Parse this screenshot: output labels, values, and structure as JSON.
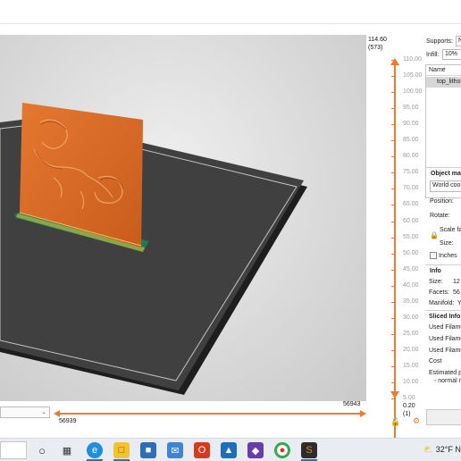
{
  "vertical_slider": {
    "top_value": "114.60",
    "top_layer": "(573)",
    "ticks": [
      "110.00",
      "105.00",
      "100.00",
      "95.00",
      "90.00",
      "85.00",
      "80.00",
      "75.00",
      "70.00",
      "65.00",
      "60.00",
      "55.00",
      "50.00",
      "45.00",
      "40.00",
      "35.00",
      "30.00",
      "25.00",
      "20.00",
      "15.00",
      "10.00",
      "5.00"
    ],
    "bottom_value": "0.20",
    "bottom_layer": "(1)",
    "accent": "#f07a2a"
  },
  "horizontal_slider": {
    "view_select_value": "",
    "left_value": "56939",
    "right_value": "56943"
  },
  "right_panel": {
    "supports_label": "Supports:",
    "supports_value": "N",
    "infill_label": "Infill:",
    "infill_value": "10%",
    "object_list_header": "Name",
    "object_list_item": "top_litho",
    "object_manipulation_title": "Object ma",
    "coordinates_select": "World coo",
    "position_label": "Position:",
    "rotate_label": "Rotate:",
    "scale_label": "Scale fa",
    "size_label": "Size:",
    "inches_label": "Inches",
    "info_title": "Info",
    "info_size_label": "Size:",
    "info_size_value": "12",
    "info_facets_label": "Facets:",
    "info_facets_value": "56",
    "info_manifold_label": "Manifold:",
    "info_manifold_value": "Ye",
    "sliced_info_title": "Sliced Info",
    "used_filament_1": "Used Filame",
    "used_filament_2": "Used Filame",
    "used_filament_3": "Used Filame",
    "cost_label": "Cost",
    "estimated_label": "Estimated p",
    "normal_mode_label": "- normal m"
  },
  "taskbar": {
    "icons": [
      "search-box",
      "task-view-icon",
      "widgets-icon",
      "edge-icon",
      "file-explorer-icon",
      "store-icon",
      "mail-icon",
      "office-icon",
      "app-icon-blue",
      "app-icon-purple",
      "chrome-icon",
      "prusaslicer-icon"
    ],
    "weather_temp": "32°F",
    "weather_extra": "N"
  }
}
